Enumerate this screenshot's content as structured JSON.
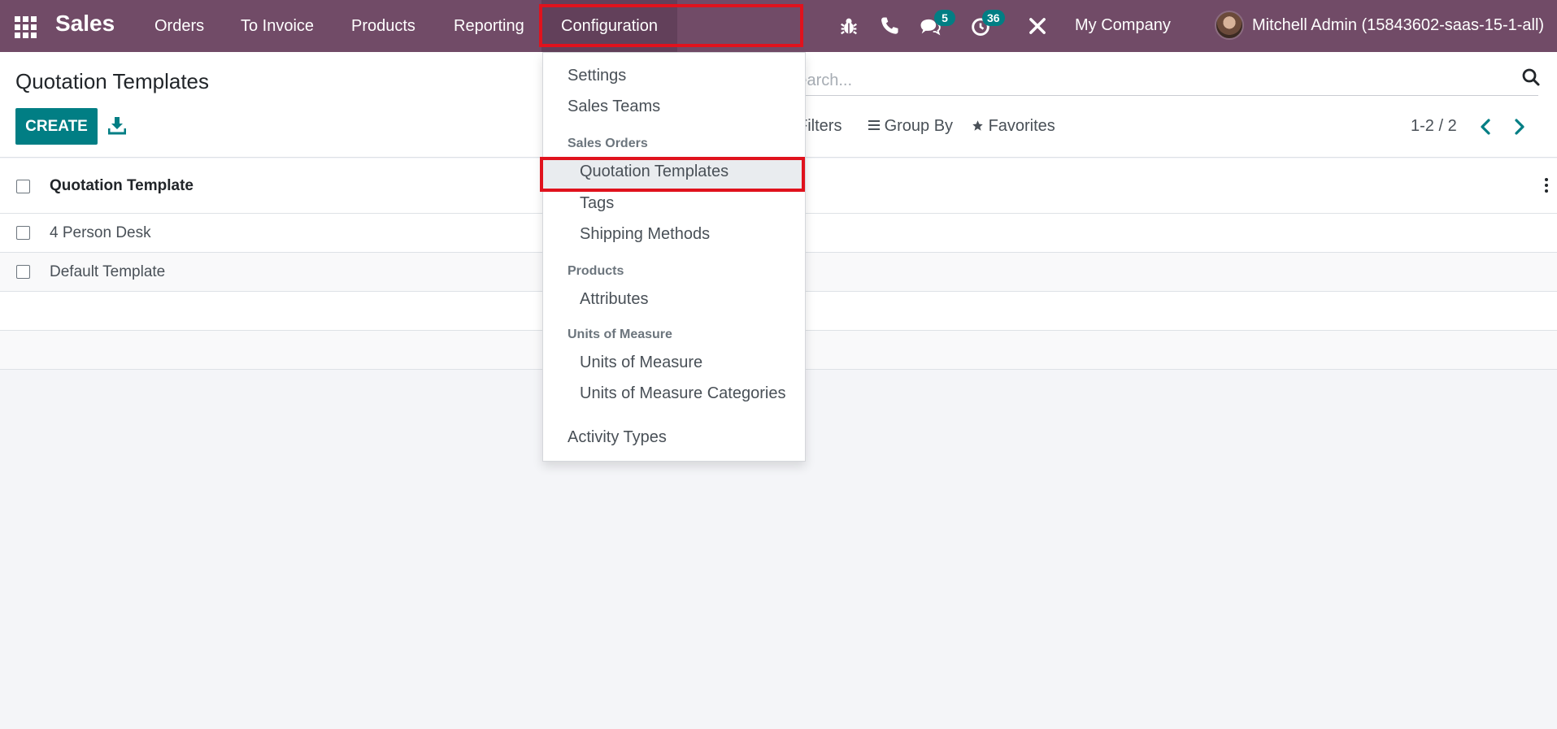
{
  "navbar": {
    "brand": "Sales",
    "menus": [
      "Orders",
      "To Invoice",
      "Products",
      "Reporting",
      "Configuration"
    ],
    "active_menu": "Configuration",
    "messages_badge": "5",
    "activities_badge": "36",
    "company": "My Company",
    "user": "Mitchell Admin (15843602-saas-15-1-all)"
  },
  "control_panel": {
    "title": "Quotation Templates",
    "create_label": "CREATE",
    "search_placeholder": "Search...",
    "filters_label": "Filters",
    "groupby_label": "Group By",
    "favorites_label": "Favorites",
    "pager": "1-2 / 2"
  },
  "list": {
    "column": "Quotation Template",
    "rows": [
      "4 Person Desk",
      "Default Template"
    ]
  },
  "dropdown": {
    "item_settings": "Settings",
    "item_sales_teams": "Sales Teams",
    "header_sales_orders": "Sales Orders",
    "item_quotation_templates": "Quotation Templates",
    "item_tags": "Tags",
    "item_shipping_methods": "Shipping Methods",
    "header_products": "Products",
    "item_attributes": "Attributes",
    "header_uom": "Units of Measure",
    "item_uom": "Units of Measure",
    "item_uom_categories": "Units of Measure Categories",
    "item_activity_types": "Activity Types"
  },
  "colors": {
    "navbar": "#714b67",
    "primary": "#017e84",
    "highlight": "#e0121d"
  },
  "icons": [
    "apps-grid-icon",
    "bug-icon",
    "phone-icon",
    "chat-icon",
    "clock-icon",
    "tools-icon",
    "download-icon",
    "search-icon",
    "list-icon",
    "star-icon",
    "chevron-left-icon",
    "chevron-right-icon",
    "kebab-icon"
  ]
}
